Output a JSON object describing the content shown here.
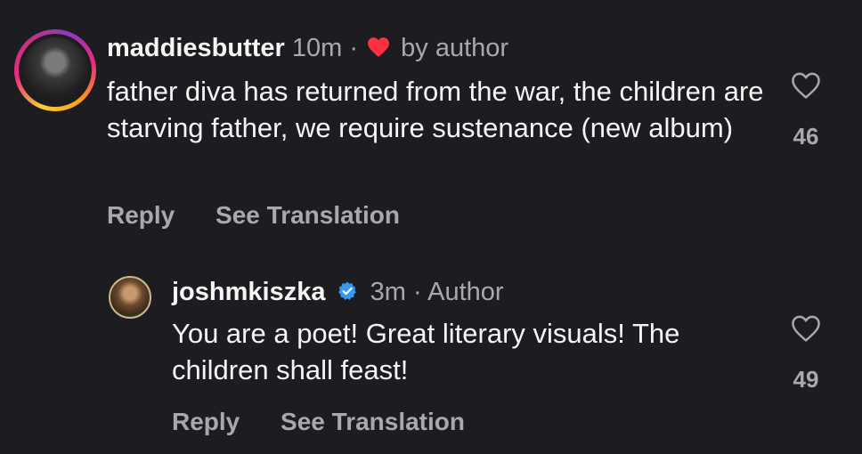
{
  "comments": [
    {
      "username": "maddiesbutter",
      "time": "10m",
      "separator": "·",
      "liked_by_label": "by author",
      "text": "father diva has returned from the war, the children are starving father, we require sustenance (new album)",
      "like_count": "46",
      "reply_label": "Reply",
      "translate_label": "See Translation",
      "has_story_ring": true
    },
    {
      "username": "joshmkiszka",
      "verified": true,
      "time": "3m",
      "separator": "·",
      "role_label": "Author",
      "text": "You are a poet! Great literary visuals! The children shall feast!",
      "like_count": "49",
      "reply_label": "Reply",
      "translate_label": "See Translation"
    }
  ],
  "colors": {
    "background": "#1c1c21",
    "text_primary": "#f5f5f5",
    "text_secondary": "#a8a8b0",
    "heart_red": "#ff3040",
    "verified_blue": "#3897f0"
  },
  "icons": {
    "author_liked": "heart-filled-icon",
    "like_button": "heart-outline-icon",
    "verified": "verified-badge-icon"
  }
}
